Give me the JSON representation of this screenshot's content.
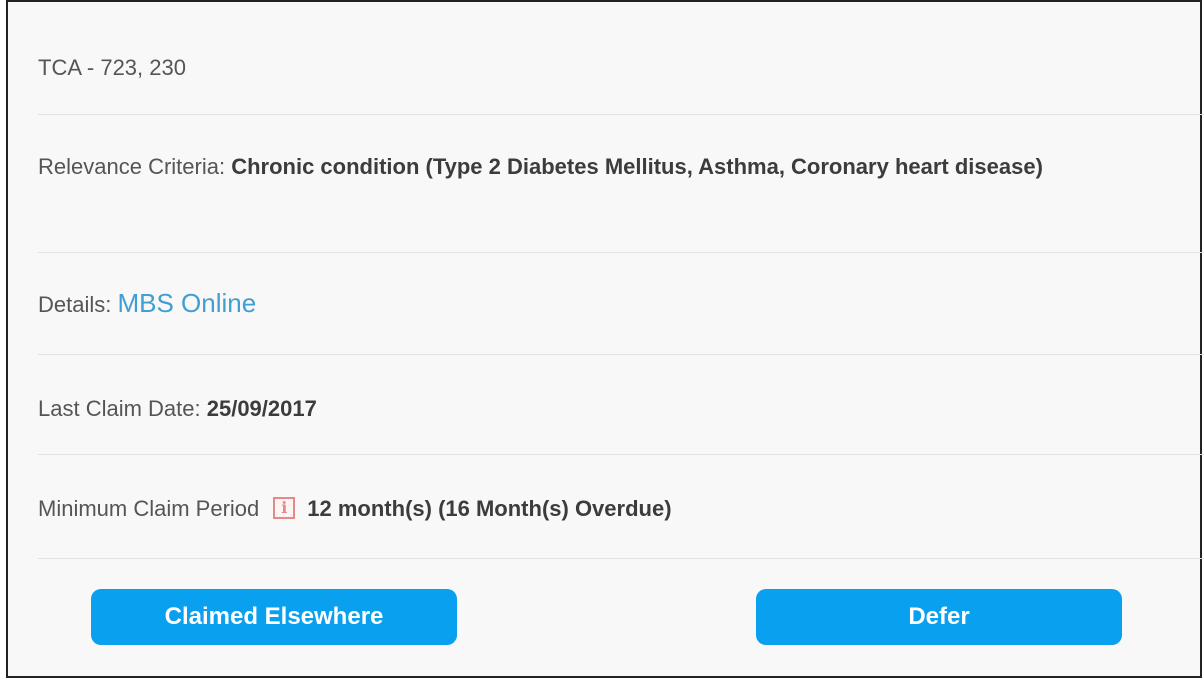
{
  "item": {
    "code": "TCA - 723, 230",
    "relevance_label": "Relevance Criteria: ",
    "relevance_value": "Chronic condition (Type 2 Diabetes Mellitus, Asthma, Coronary heart disease)",
    "details_label": "Details: ",
    "details_link": "MBS Online",
    "last_claim_label": "Last Claim Date: ",
    "last_claim_value": "25/09/2017",
    "min_period_label": "Minimum Claim Period",
    "min_period_value": "12 month(s) (16 Month(s) Overdue)"
  },
  "icons": {
    "info_icon_glyph": "i"
  },
  "actions": {
    "claimed_elsewhere_label": "Claimed Elsewhere",
    "defer_label": "Defer"
  },
  "colors": {
    "button": "#0aa0f0",
    "link": "#3f9fd3",
    "info_icon": "#e58a8a"
  }
}
